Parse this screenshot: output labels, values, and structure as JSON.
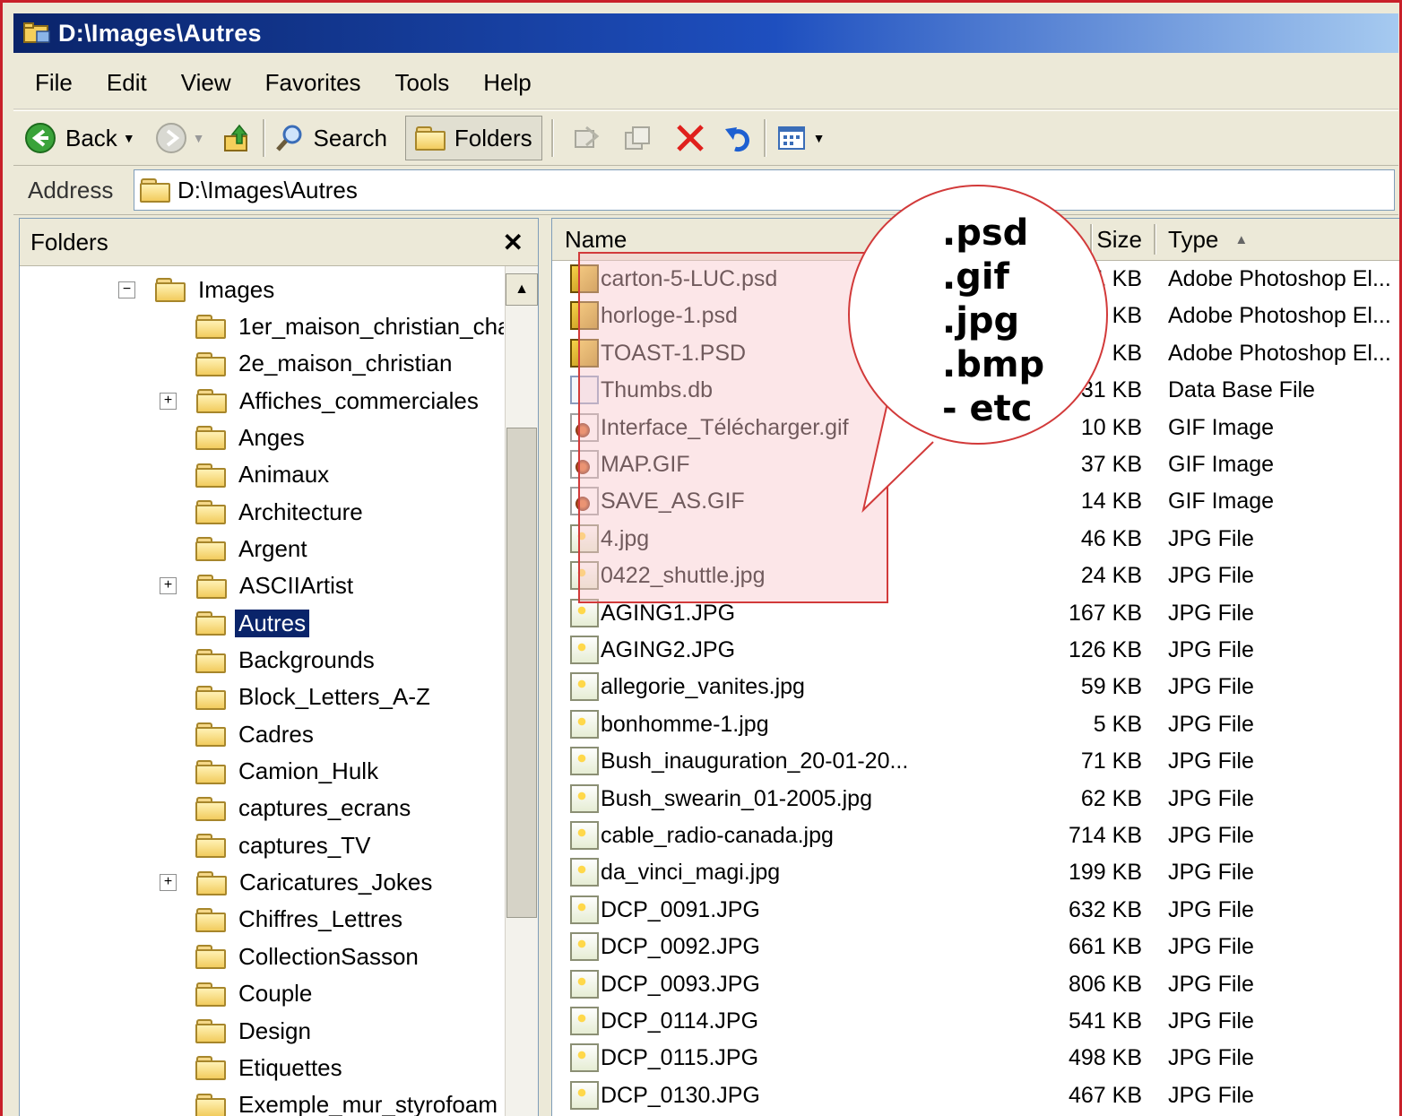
{
  "window": {
    "title": "D:\\Images\\Autres"
  },
  "menu": [
    "File",
    "Edit",
    "View",
    "Favorites",
    "Tools",
    "Help"
  ],
  "toolbar": {
    "back_label": "Back",
    "search_label": "Search",
    "folders_label": "Folders"
  },
  "address": {
    "label": "Address",
    "value": "D:\\Images\\Autres"
  },
  "folders_pane": {
    "title": "Folders",
    "tree": [
      {
        "label": "Images",
        "level": 0,
        "expander": "-"
      },
      {
        "label": "1er_maison_christian_cha",
        "level": 1
      },
      {
        "label": "2e_maison_christian",
        "level": 1
      },
      {
        "label": "Affiches_commerciales",
        "level": 1,
        "expander": "+"
      },
      {
        "label": "Anges",
        "level": 1
      },
      {
        "label": "Animaux",
        "level": 1
      },
      {
        "label": "Architecture",
        "level": 1
      },
      {
        "label": "Argent",
        "level": 1
      },
      {
        "label": "ASCIIArtist",
        "level": 1,
        "expander": "+"
      },
      {
        "label": "Autres",
        "level": 1,
        "selected": true
      },
      {
        "label": "Backgrounds",
        "level": 1
      },
      {
        "label": "Block_Letters_A-Z",
        "level": 1
      },
      {
        "label": "Cadres",
        "level": 1
      },
      {
        "label": "Camion_Hulk",
        "level": 1
      },
      {
        "label": "captures_ecrans",
        "level": 1
      },
      {
        "label": "captures_TV",
        "level": 1
      },
      {
        "label": "Caricatures_Jokes",
        "level": 1,
        "expander": "+"
      },
      {
        "label": "Chiffres_Lettres",
        "level": 1
      },
      {
        "label": "CollectionSasson",
        "level": 1
      },
      {
        "label": "Couple",
        "level": 1
      },
      {
        "label": "Design",
        "level": 1
      },
      {
        "label": "Etiquettes",
        "level": 1
      },
      {
        "label": "Exemple_mur_styrofoam",
        "level": 1
      }
    ]
  },
  "file_list": {
    "columns": {
      "name": "Name",
      "size": "Size",
      "type": "Type"
    },
    "sort_indicator": "▲",
    "rows": [
      {
        "name": "carton-5-LUC.psd",
        "size": "1 KB",
        "type": "Adobe Photoshop El...",
        "icon": "psd-icon"
      },
      {
        "name": "horloge-1.psd",
        "size": "KB",
        "type": "Adobe Photoshop El...",
        "icon": "psd-icon"
      },
      {
        "name": "TOAST-1.PSD",
        "size": "KB",
        "type": "Adobe Photoshop El...",
        "icon": "psd-icon"
      },
      {
        "name": "Thumbs.db",
        "size": "31 KB",
        "type": "Data Base File",
        "icon": "db-icon"
      },
      {
        "name": "Interface_Télécharger.gif",
        "size": "10 KB",
        "type": "GIF Image",
        "icon": "gif-icon"
      },
      {
        "name": "MAP.GIF",
        "size": "37 KB",
        "type": "GIF Image",
        "icon": "gif-icon"
      },
      {
        "name": "SAVE_AS.GIF",
        "size": "14 KB",
        "type": "GIF Image",
        "icon": "gif-icon"
      },
      {
        "name": "4.jpg",
        "size": "46 KB",
        "type": "JPG File",
        "icon": "jpg-icon"
      },
      {
        "name": "0422_shuttle.jpg",
        "size": "24 KB",
        "type": "JPG File",
        "icon": "jpg-icon"
      },
      {
        "name": "AGING1.JPG",
        "size": "167 KB",
        "type": "JPG File",
        "icon": "jpg-icon"
      },
      {
        "name": "AGING2.JPG",
        "size": "126 KB",
        "type": "JPG File",
        "icon": "jpg-icon"
      },
      {
        "name": "allegorie_vanites.jpg",
        "size": "59 KB",
        "type": "JPG File",
        "icon": "jpg-icon"
      },
      {
        "name": "bonhomme-1.jpg",
        "size": "5 KB",
        "type": "JPG File",
        "icon": "jpg-icon"
      },
      {
        "name": "Bush_inauguration_20-01-20...",
        "size": "71 KB",
        "type": "JPG File",
        "icon": "jpg-icon"
      },
      {
        "name": "Bush_swearin_01-2005.jpg",
        "size": "62 KB",
        "type": "JPG File",
        "icon": "jpg-icon"
      },
      {
        "name": "cable_radio-canada.jpg",
        "size": "714 KB",
        "type": "JPG File",
        "icon": "jpg-icon"
      },
      {
        "name": "da_vinci_magi.jpg",
        "size": "199 KB",
        "type": "JPG File",
        "icon": "jpg-icon"
      },
      {
        "name": "DCP_0091.JPG",
        "size": "632 KB",
        "type": "JPG File",
        "icon": "jpg-icon"
      },
      {
        "name": "DCP_0092.JPG",
        "size": "661 KB",
        "type": "JPG File",
        "icon": "jpg-icon"
      },
      {
        "name": "DCP_0093.JPG",
        "size": "806 KB",
        "type": "JPG File",
        "icon": "jpg-icon"
      },
      {
        "name": "DCP_0114.JPG",
        "size": "541 KB",
        "type": "JPG File",
        "icon": "jpg-icon"
      },
      {
        "name": "DCP_0115.JPG",
        "size": "498 KB",
        "type": "JPG File",
        "icon": "jpg-icon"
      },
      {
        "name": "DCP_0130.JPG",
        "size": "467 KB",
        "type": "JPG File",
        "icon": "jpg-icon"
      }
    ]
  },
  "callout": {
    "lines": [
      ".psd",
      ".gif",
      ".jpg",
      ".bmp",
      "- etc"
    ]
  },
  "colors": {
    "title_bar": "#0a246a",
    "selection": "#0a246a",
    "annotation_red": "#d23a3a",
    "annotation_fill": "#f8c8cd"
  }
}
